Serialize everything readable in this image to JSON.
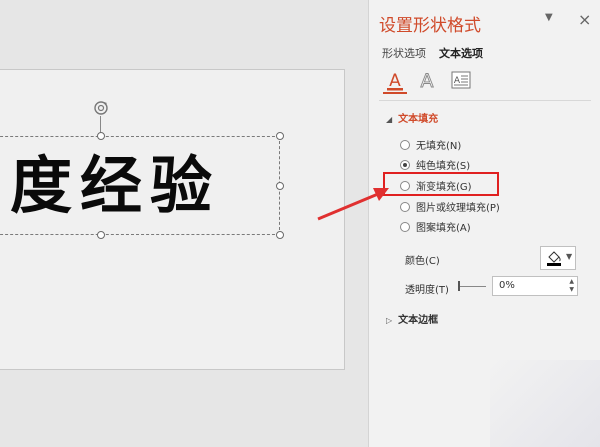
{
  "slide": {
    "text": "度经验"
  },
  "pane": {
    "title": "设置形状格式",
    "dropdown_icon": "▼",
    "close_icon": "×",
    "tabs": [
      "形状选项",
      "文本选项"
    ],
    "active_tab": "文本选项",
    "fill_section": {
      "label": "文本填充",
      "options": [
        "无填充(N)",
        "纯色填充(S)",
        "渐变填充(G)",
        "图片或纹理填充(P)",
        "图案填充(A)"
      ],
      "selected": "纯色填充(S)",
      "highlighted": "渐变填充(G)"
    },
    "color_label": "颜色(C)",
    "transparency_label": "透明度(T)",
    "transparency_value": "0%",
    "border_section_label": "文本边框"
  },
  "colors": {
    "accent": "#d04a2a",
    "highlight_box": "#e02020",
    "arrow": "#e03030"
  }
}
